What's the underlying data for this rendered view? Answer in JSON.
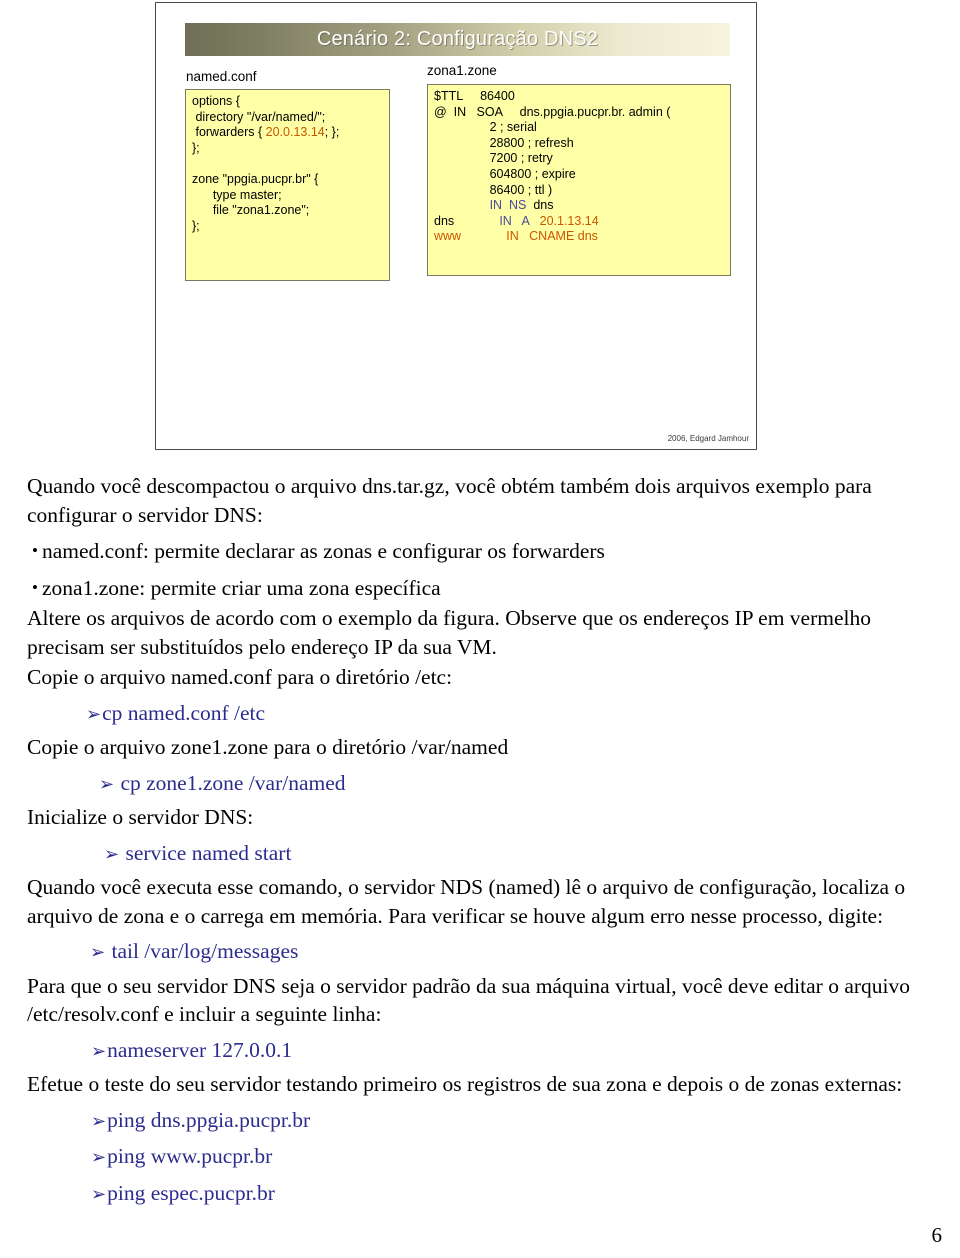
{
  "slide": {
    "title": "Cenário 2: Configuração DNS2",
    "copyright": "2006, Edgard Jamhour",
    "named_conf": {
      "label": "named.conf",
      "lines": [
        {
          "text": "options {",
          "color": "black"
        },
        {
          "text": " directory \"/var/named/\";",
          "color": "black"
        },
        {
          "text": " forwarders { ",
          "color": "black",
          "tail": "20.0.13.14",
          "tail_color": "#cc5500",
          "after": "; };"
        },
        {
          "text": "};",
          "color": "black"
        },
        {
          "text": "",
          "color": "black"
        },
        {
          "text": "zone \"ppgia.pucpr.br\" {",
          "color": "black"
        },
        {
          "text": "      type master;",
          "color": "black"
        },
        {
          "text": "      file \"zona1.zone\";",
          "color": "black"
        },
        {
          "text": "};",
          "color": "black"
        }
      ]
    },
    "zona1_zone": {
      "label": "zona1.zone",
      "lines": [
        "$TTL     86400",
        "@  IN   SOA      dns.ppgia.pucpr.br. admin (",
        "                 2 ; serial",
        "                 28800 ; refresh",
        "                 7200 ; retry",
        "                 604800 ; expire",
        "                 86400 ; ttl )",
        "                 IN  NS  dns",
        "dns              IN  A    20.1.13.14",
        "www              IN  CNAME dns"
      ]
    }
  },
  "body": {
    "p1": "Quando você descompactou o arquivo dns.tar.gz, você obtém também dois arquivos exemplo para configurar o servidor DNS:",
    "b1": "named.conf: permite declarar as zonas e configurar os forwarders",
    "b2": "zona1.zone: permite criar uma zona específica",
    "p2": "Altere os arquivos de acordo com o exemplo da figura. Observe que os endereços IP em vermelho precisam ser substituídos pelo endereço IP da sua VM.",
    "p3": "Copie o arquivo named.conf para o diretório /etc:",
    "cmd1": "cp named.conf /etc",
    "p4": "Copie o arquivo zone1.zone para o diretório /var/named",
    "cmd2": "cp zone1.zone /var/named",
    "p5": "Inicialize o servidor DNS:",
    "cmd3": "service named start",
    "p6": "Quando você executa esse comando, o servidor NDS (named) lê o arquivo de configuração, localiza o arquivo de zona e o carrega em memória. Para verificar se houve algum erro nesse processo, digite:",
    "cmd4": "tail /var/log/messages",
    "p7": "Para que o seu servidor DNS seja o servidor padrão da sua máquina virtual, você deve editar o arquivo /etc/resolv.conf e incluir a seguinte linha:",
    "cmd5": "nameserver 127.0.0.1",
    "p8": "Efetue o teste do seu servidor testando primeiro os registros de sua zona e depois o de zonas externas:",
    "cmd6": "ping dns.ppgia.pucpr.br",
    "cmd7": "ping www.pucpr.br",
    "cmd8": "ping espec.pucpr.br",
    "bullet_marker": "•",
    "arrow_marker": "➢"
  },
  "page_number": "6",
  "colors": {
    "code_bg": "#ffffa8",
    "accent_orange": "#cc5500",
    "accent_purple": "#4a4a9c",
    "command_blue": "#2c2c8f"
  }
}
